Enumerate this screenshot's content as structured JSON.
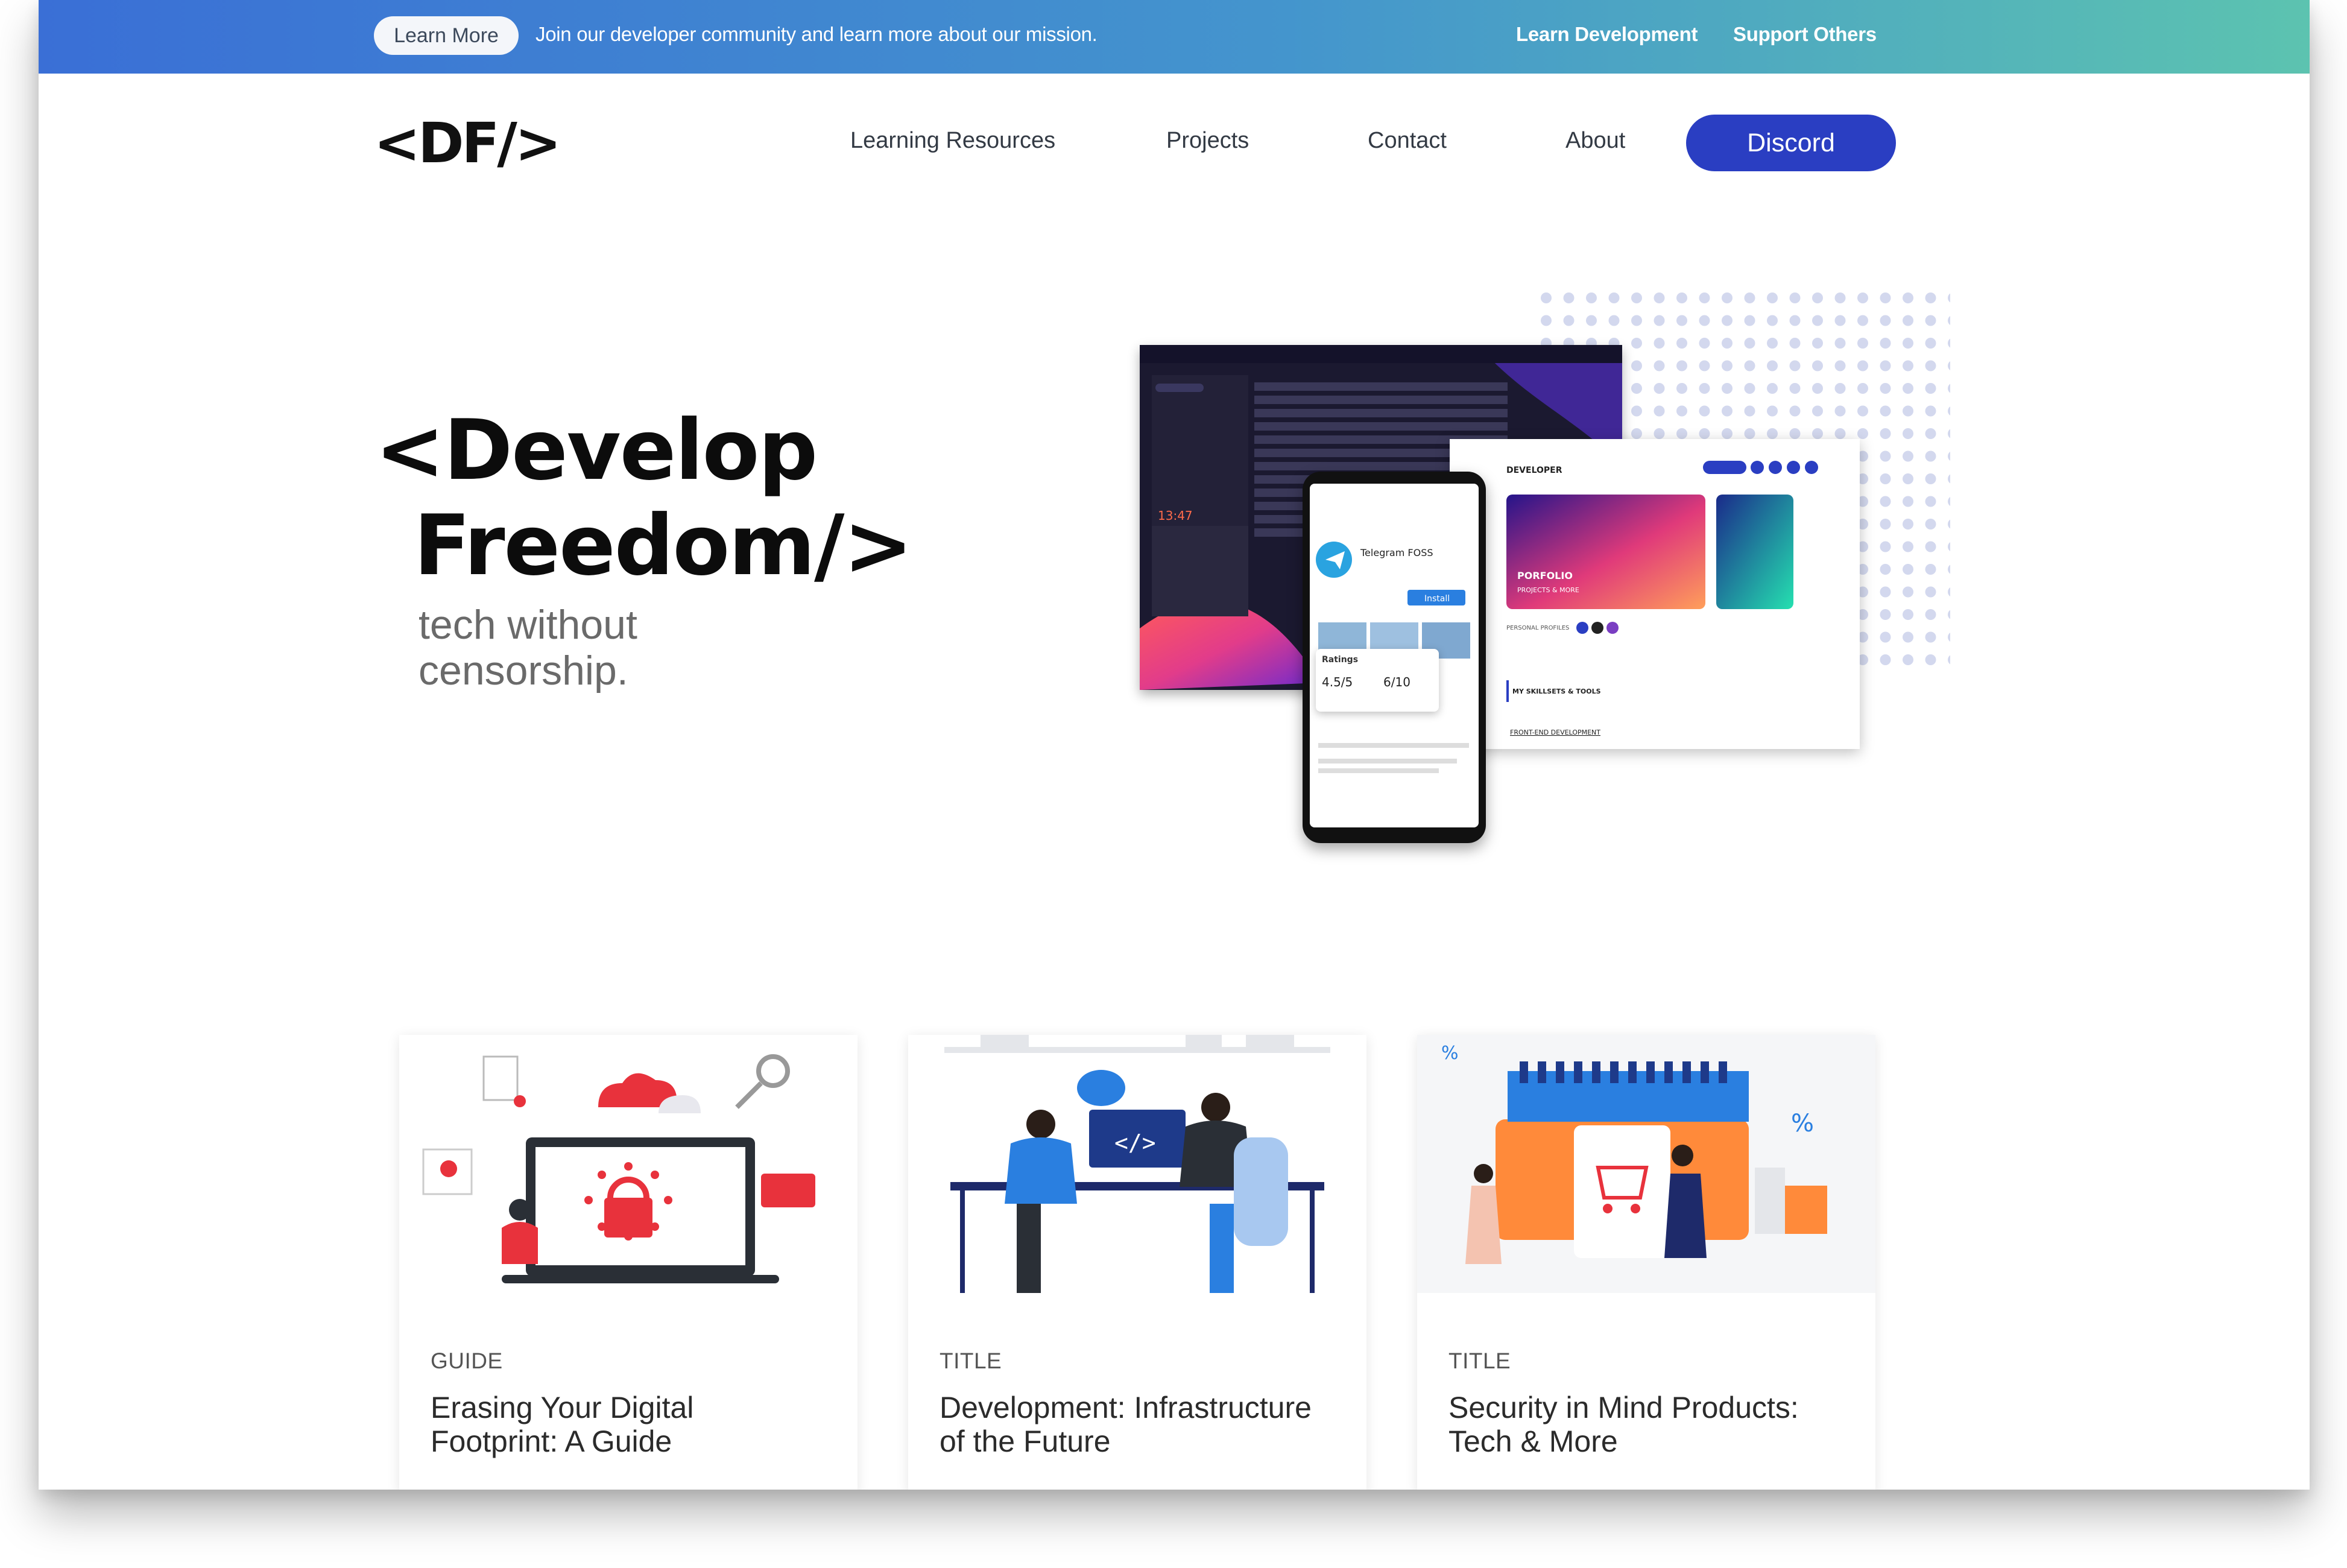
{
  "banner": {
    "learn_more_label": "Learn More",
    "message": "Join our developer community and learn more about our mission.",
    "link_learn_development": "Learn Development",
    "link_support_others": "Support Others",
    "gradient_start": "#3a6fd6",
    "gradient_end": "#5cc3b0"
  },
  "nav": {
    "logo": "<DF/>",
    "items": [
      {
        "label": "Learning Resources"
      },
      {
        "label": "Projects"
      },
      {
        "label": "Contact"
      },
      {
        "label": "About"
      }
    ],
    "discord_label": "Discord",
    "discord_color": "#2a3ec2"
  },
  "hero": {
    "title_line1": "<Develop",
    "title_line2": "Freedom/>",
    "tagline_line1": "tech without",
    "tagline_line2": "censorship."
  },
  "illustration": {
    "phone_app_name": "Telegram FOSS",
    "phone_install_label": "Install",
    "ratings_label": "Ratings",
    "rating_value": "4.5/5",
    "privacy_value": "6/10",
    "portfolio_header": "DEVELOPER",
    "portfolio_card_label": "PORFOLIO",
    "portfolio_card_sub": "PROJECTS & MORE",
    "portfolio_skills": "MY SKILLSETS & TOOLS",
    "portfolio_link": "FRONT-END DEVELOPMENT",
    "desktop_clock": "13:47"
  },
  "cards": [
    {
      "category": "GUIDE",
      "title": "Erasing Your Digital Footprint: A Guide",
      "icon": "privacy-lock-illustration"
    },
    {
      "category": "TITLE",
      "title": "Development: Infrastructure of the Future",
      "icon": "developers-coding-illustration"
    },
    {
      "category": "TITLE",
      "title": "Security in Mind Products: Tech & More",
      "icon": "shopping-sale-illustration"
    }
  ]
}
